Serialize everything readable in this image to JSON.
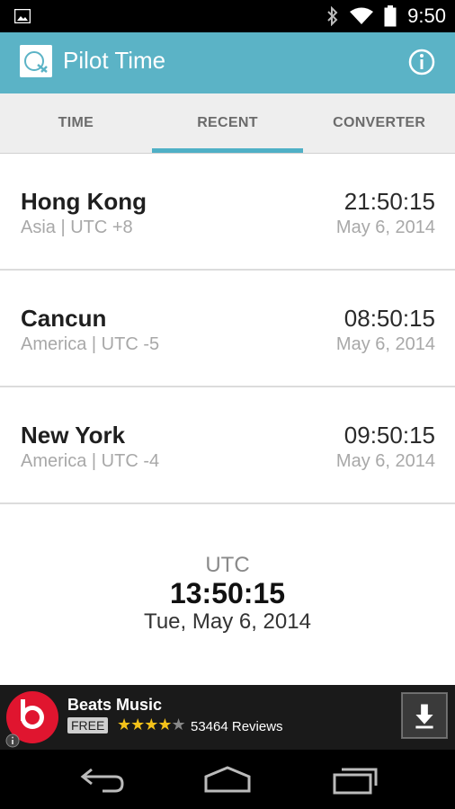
{
  "status_bar": {
    "time": "9:50",
    "icons": [
      "image-icon",
      "bluetooth-icon",
      "wifi-icon",
      "battery-icon"
    ]
  },
  "app_bar": {
    "title": "Pilot Time",
    "brand_color": "#5bb3c6"
  },
  "tabs": [
    {
      "label": "TIME",
      "active": false
    },
    {
      "label": "RECENT",
      "active": true
    },
    {
      "label": "CONVERTER",
      "active": false
    }
  ],
  "recent": [
    {
      "city": "Hong Kong",
      "zone": "Asia | UTC +8",
      "time": "21:50:15",
      "date": "May 6, 2014"
    },
    {
      "city": "Cancun",
      "zone": "America | UTC -5",
      "time": "08:50:15",
      "date": "May 6, 2014"
    },
    {
      "city": "New York",
      "zone": "America | UTC -4",
      "time": "09:50:15",
      "date": "May 6, 2014"
    }
  ],
  "utc": {
    "label": "UTC",
    "time": "13:50:15",
    "date": "Tue, May 6, 2014"
  },
  "ad": {
    "app_name": "Beats Music",
    "price": "FREE",
    "rating": 4,
    "reviews": "53464 Reviews",
    "icon_color": "#e0152f"
  }
}
